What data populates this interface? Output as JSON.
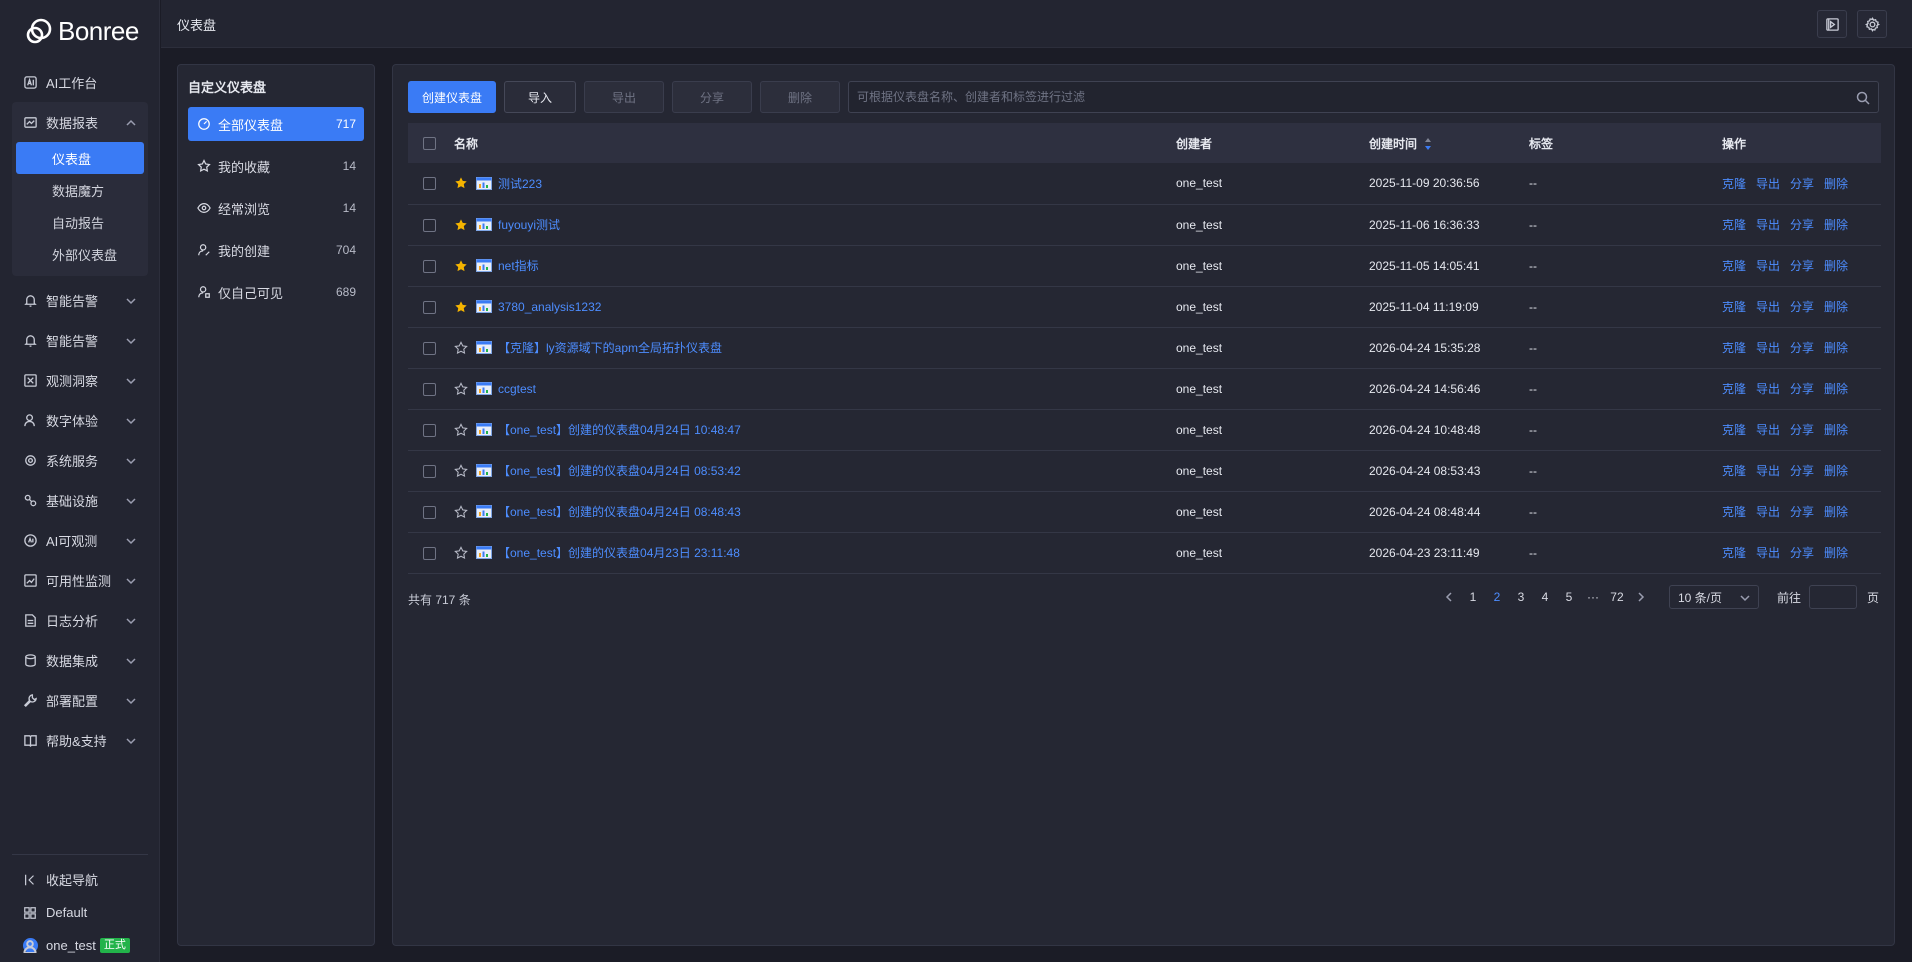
{
  "brand": {
    "name": "Bonree"
  },
  "sidebar": {
    "items": [
      {
        "label": "AI工作台",
        "icon": "ai-workbench-icon"
      },
      {
        "label": "数据报表",
        "icon": "report-icon",
        "expanded": true,
        "children": [
          {
            "label": "仪表盘",
            "active": true
          },
          {
            "label": "数据魔方"
          },
          {
            "label": "自动报告"
          },
          {
            "label": "外部仪表盘"
          }
        ]
      },
      {
        "label": "智能告警",
        "icon": "alert-icon"
      },
      {
        "label": "智能告警",
        "icon": "alert-icon"
      },
      {
        "label": "观测洞察",
        "icon": "insight-icon"
      },
      {
        "label": "数字体验",
        "icon": "user-experience-icon"
      },
      {
        "label": "系统服务",
        "icon": "system-service-icon"
      },
      {
        "label": "基础设施",
        "icon": "infrastructure-icon"
      },
      {
        "label": "AI可观测",
        "icon": "ai-observe-icon"
      },
      {
        "label": "可用性监测",
        "icon": "availability-icon"
      },
      {
        "label": "日志分析",
        "icon": "log-icon"
      },
      {
        "label": "数据集成",
        "icon": "integration-icon"
      },
      {
        "label": "部署配置",
        "icon": "deploy-icon"
      },
      {
        "label": "帮助&支持",
        "icon": "help-icon"
      }
    ],
    "bottom": {
      "collapse": "收起导航",
      "workspace": "Default",
      "user": "one_test",
      "user_badge": "正式"
    }
  },
  "header": {
    "title": "仪表盘"
  },
  "category_panel": {
    "title": "自定义仪表盘",
    "items": [
      {
        "label": "全部仪表盘",
        "count": "717",
        "icon": "dashboard-gauge-icon",
        "active": true
      },
      {
        "label": "我的收藏",
        "count": "14",
        "icon": "star-icon"
      },
      {
        "label": "经常浏览",
        "count": "14",
        "icon": "eye-icon"
      },
      {
        "label": "我的创建",
        "count": "704",
        "icon": "user-edit-icon"
      },
      {
        "label": "仅自己可见",
        "count": "689",
        "icon": "user-lock-icon"
      }
    ]
  },
  "toolbar": {
    "create": "创建仪表盘",
    "import": "导入",
    "export": "导出",
    "share": "分享",
    "delete": "删除",
    "search_placeholder": "可根据仪表盘名称、创建者和标签进行过滤"
  },
  "table": {
    "columns": {
      "name": "名称",
      "creator": "创建者",
      "created": "创建时间",
      "tags": "标签",
      "actions": "操作"
    },
    "action_labels": {
      "clone": "克隆",
      "export": "导出",
      "share": "分享",
      "delete": "删除"
    },
    "rows": [
      {
        "name": "测试223",
        "creator": "one_test",
        "created": "2025-11-09 20:36:56",
        "tags": "--",
        "favorite": true
      },
      {
        "name": "fuyouyi测试",
        "creator": "one_test",
        "created": "2025-11-06 16:36:33",
        "tags": "--",
        "favorite": true
      },
      {
        "name": "net指标",
        "creator": "one_test",
        "created": "2025-11-05 14:05:41",
        "tags": "--",
        "favorite": true
      },
      {
        "name": "3780_analysis1232",
        "creator": "one_test",
        "created": "2025-11-04 11:19:09",
        "tags": "--",
        "favorite": true
      },
      {
        "name": "【克隆】ly资源域下的apm全局拓扑仪表盘",
        "creator": "one_test",
        "created": "2026-04-24 15:35:28",
        "tags": "--",
        "favorite": false
      },
      {
        "name": "ccgtest",
        "creator": "one_test",
        "created": "2026-04-24 14:56:46",
        "tags": "--",
        "favorite": false
      },
      {
        "name": "【one_test】创建的仪表盘04月24日 10:48:47",
        "creator": "one_test",
        "created": "2026-04-24 10:48:48",
        "tags": "--",
        "favorite": false
      },
      {
        "name": "【one_test】创建的仪表盘04月24日 08:53:42",
        "creator": "one_test",
        "created": "2026-04-24 08:53:43",
        "tags": "--",
        "favorite": false
      },
      {
        "name": "【one_test】创建的仪表盘04月24日 08:48:43",
        "creator": "one_test",
        "created": "2026-04-24 08:48:44",
        "tags": "--",
        "favorite": false
      },
      {
        "name": "【one_test】创建的仪表盘04月23日 23:11:48",
        "creator": "one_test",
        "created": "2026-04-23 23:11:49",
        "tags": "--",
        "favorite": false
      }
    ]
  },
  "pagination": {
    "total": "共有 717 条",
    "pages": [
      "1",
      "2",
      "3",
      "4",
      "5"
    ],
    "current": "2",
    "ellipsis": "···",
    "last": "72",
    "page_size": "10 条/页",
    "goto_label": "前往",
    "goto_unit": "页"
  },
  "colors": {
    "accent": "#3a7bf5",
    "link": "#4d8dff",
    "star": "#f5b400",
    "badge": "#22b34a"
  }
}
